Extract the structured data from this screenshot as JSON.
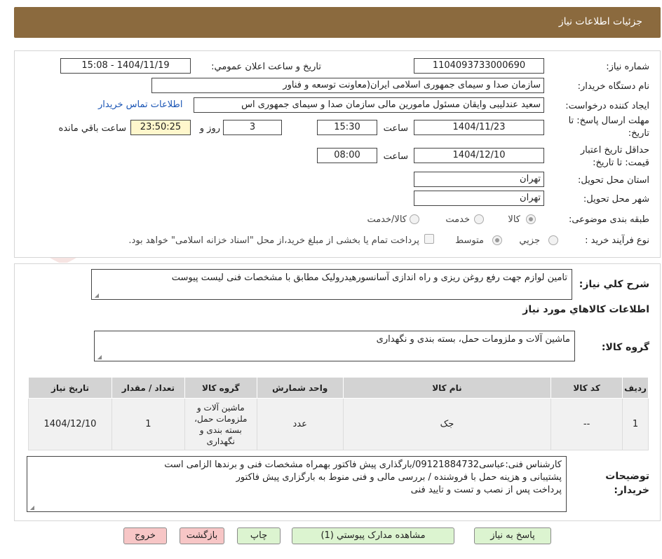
{
  "header": {
    "title": "جزئیات اطلاعات نیاز"
  },
  "info": {
    "need_number_label": "شماره نیاز:",
    "need_number": "1104093733000690",
    "announce_label": "تاریخ و ساعت اعلان عمومي:",
    "announce_value": "1404/11/19 - 15:08",
    "buyer_org_label": "نام دستگاه خريدار:",
    "buyer_org": "سازمان صدا و سیمای جمهوری اسلامی ایران(معاونت توسعه و فناور",
    "creator_label": "ايجاد کننده درخواست:",
    "creator": "سعید عندلیبی وایقان مسئول مامورین مالی  سازمان صدا و سیمای جمهوری اس",
    "contact_link": "اطلاعات تماس خريدار",
    "deadline_label_1": "مهلت ارسال پاسخ: تا",
    "deadline_label_2": "تاريخ:",
    "deadline_date": "1404/11/23",
    "time_label": "ساعت",
    "deadline_time": "15:30",
    "days_value": "3",
    "days_label": "روز و",
    "remaining_time": "23:50:25",
    "remaining_label": "ساعت باقي مانده",
    "validity_label_1": "حداقل تاريخ اعتبار",
    "validity_label_2": "قيمت: تا تاريخ:",
    "validity_date": "1404/12/10",
    "validity_time_label": "ساعت",
    "validity_time": "08:00",
    "province_label": "استان محل تحويل:",
    "province": "تهران",
    "city_label": "شهر محل تحويل:",
    "city": "تهران",
    "category_label": "طبقه بندی موضوعی:",
    "category_options": [
      "کالا",
      "خدمت",
      "کالا/خدمت"
    ],
    "process_label": "نوع فرآيند خريد :",
    "process_options": [
      "جزيي",
      "متوسط"
    ],
    "process_note": "پرداخت تمام يا بخشی از مبلغ خريد،از محل \"اسناد خزانه اسلامی\" خواهد بود."
  },
  "description": {
    "label": "شرح کلي نياز:",
    "text": "تامین لوازم جهت رفع روغن ریزی و راه اندازی آسانسورهیدرولیک مطابق با مشخصات فنی لیست پیوست"
  },
  "goods": {
    "section_title": "اطلاعات کالاهاي مورد نياز",
    "group_label": "گروه کالا:",
    "group_value": "ماشین آلات و ملزومات حمل، بسته بندی و نگهداری"
  },
  "table": {
    "headers": [
      "رديف",
      "کد کالا",
      "نام کالا",
      "واحد شمارش",
      "گروه کالا",
      "تعداد / مقدار",
      "تاريخ نياز"
    ],
    "rows": [
      [
        "1",
        "--",
        "جک",
        "عدد",
        "ماشین آلات و ملزومات حمل، بسته بندی و نگهداری",
        "1",
        "1404/12/10"
      ]
    ]
  },
  "buyer_notes": {
    "label_1": "توضيحات",
    "label_2": "خريدار:",
    "line1": "کارشناس فنی:عباسی09121884732/بارگذاری پیش فاکتور بهمراه مشخصات فنی و برندها الزامی است",
    "line2": "پشتیبانی و هزینه حمل با فروشنده / بررسی مالی و فنی منوط به بارگزاری پیش فاکتور",
    "line3": "پرداخت پس از نصب و تست و تایید فنی"
  },
  "buttons": {
    "reply": "پاسخ به نياز",
    "attachments": "مشاهده مدارک پيوستي (1)",
    "print": "چاپ",
    "back": "بازگشت",
    "exit": "خروج"
  },
  "watermark": {
    "text": "AriaTender.neT"
  }
}
